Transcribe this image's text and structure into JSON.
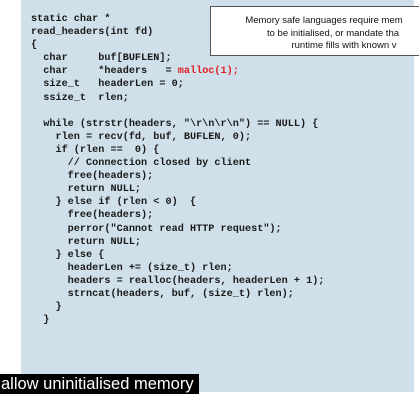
{
  "code": {
    "lines": [
      "static char *",
      "read_headers(int fd)",
      "{",
      "  char     buf[BUFLEN];",
      "  char     *headers   = ",
      "  size_t   headerLen = 0;",
      "  ssize_t  rlen;",
      "",
      "  while (strstr(headers, \"\\r\\n\\r\\n\") == NULL) {",
      "    rlen = recv(fd, buf, BUFLEN, 0);",
      "    if (rlen ==  0) {",
      "      // Connection closed by client",
      "      free(headers);",
      "      return NULL;",
      "    } else if (rlen < 0)  {",
      "      free(headers);",
      "      perror(\"Cannot read HTTP request\");",
      "      return NULL;",
      "    } else {",
      "      headerLen += (size_t) rlen;",
      "      headers = realloc(headers, headerLen + 1);",
      "      strncat(headers, buf, (size_t) rlen);",
      "    }",
      "  }"
    ],
    "highlight": "malloc(1);",
    "highlight_color": "#e02020"
  },
  "callout": {
    "line1": "Memory safe languages require mem",
    "line2": "to be initialised, or mandate tha",
    "line3": "runtime fills with known v"
  },
  "caption": "allow uninitialised memory",
  "colors": {
    "panel_background": "#cfe0ea",
    "caption_background": "#000000",
    "caption_text": "#ffffff"
  }
}
